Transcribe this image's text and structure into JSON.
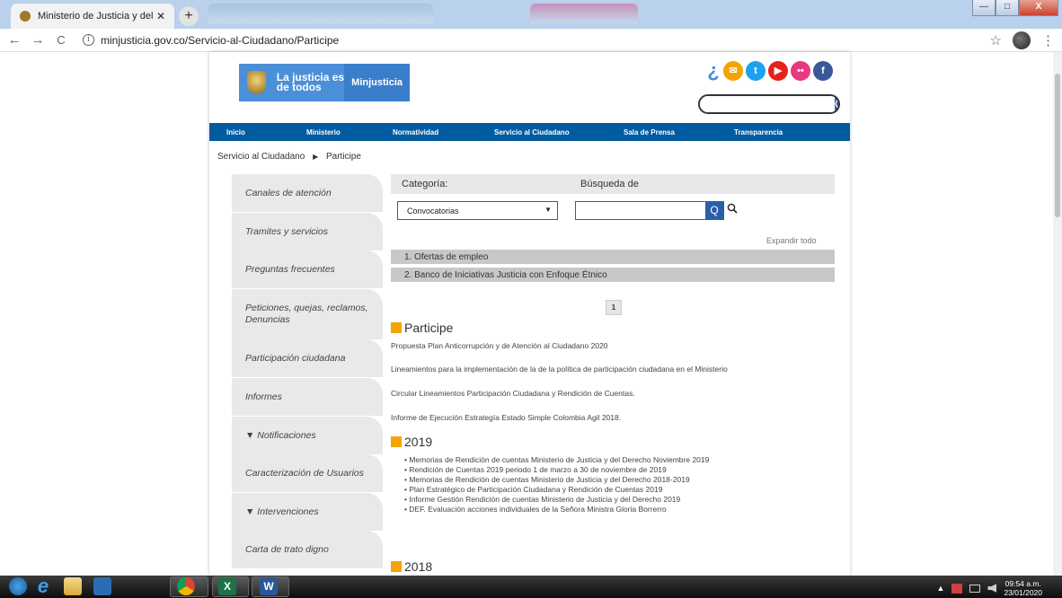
{
  "browser": {
    "tab_title": "Ministerio de Justicia y del Dere¢",
    "tab_close": "✕",
    "new_tab": "+",
    "url": "minjusticia.gov.co/Servicio-al-Ciudadano/Participe",
    "back": "←",
    "forward": "→",
    "reload": "C",
    "info": "i",
    "star": "☆",
    "menu": "⋮",
    "win_min": "—",
    "win_max": "□",
    "win_close": "X"
  },
  "header": {
    "slogan": "La justicia es de todos",
    "brand": "Minjusticia",
    "accessibility_glyph": "¿",
    "social_icons": [
      {
        "name": "chat",
        "glyph": "✉",
        "color": "#f5a300"
      },
      {
        "name": "twitter",
        "glyph": "t",
        "color": "#1da1f2"
      },
      {
        "name": "youtube",
        "glyph": "▶",
        "color": "#e62117"
      },
      {
        "name": "flickr",
        "glyph": "••",
        "color": "#e8387f"
      },
      {
        "name": "facebook",
        "glyph": "f",
        "color": "#3b5998"
      }
    ],
    "search_glyph": "Q"
  },
  "nav": {
    "items": [
      "Inicio",
      "Ministerio",
      "Normatividad",
      "Servicio al Ciudadano",
      "Sala de Prensa",
      "Transparencia"
    ]
  },
  "breadcrumb": {
    "parent": "Servicio al Ciudadano",
    "arrow": "▶",
    "current": "Participe"
  },
  "sidebar": {
    "items": [
      "Canales de atención",
      "Tramites y servicios",
      "Preguntas frecuentes",
      "Peticiones, quejas, reclamos, Denuncias",
      "Participación ciudadana",
      "Informes",
      "▼ Notificaciones",
      "Caracterización de Usuarios",
      "▼ Intervenciones",
      "Carta de trato digno"
    ]
  },
  "filter": {
    "category_label": "Categoría:",
    "search_label": "Búsqueda de",
    "category_value": "Convocatorias",
    "caret": "▼",
    "search_glyph": "Q",
    "expand_all": "Expandir todo"
  },
  "accordion": [
    "1. Ofertas de empleo",
    "2. Banco de Iniciativas Justicia con Enfoque Étnico"
  ],
  "pager": {
    "current": "1"
  },
  "participe": {
    "title": "Participe",
    "items": [
      "Propuesta Plan Anticorrupción y de Atención al Ciudadano 2020",
      "Lineamientos para la implementación de la de la política de participación ciudadana en el Ministerio",
      "Circular Lineamientos Participación Ciudadana y Rendición de Cuentas.",
      "Informe de Ejecución Estrategía Estado Simple Colombia Agil 2018."
    ]
  },
  "year2019": {
    "title": "2019",
    "items": [
      "• Memorias de Rendición de cuentas Ministerio de Justicia y del Derecho Noviembre 2019",
      "• Rendición de Cuentas 2019 periodo 1 de marzo a 30 de noviembre de 2019",
      "• Memorias de Rendición de cuentas Ministerio de Justicia y del Derecho 2018-2019",
      "• Plan Estratégico de Participación Ciudadana y Rendición de Cuentas 2019",
      "• Informe Gestión Rendición de cuentas Ministerio de Justicia y del Derecho 2019",
      "• DEF. Evaluación acciones individuales de la Señora Ministra Gloria Borrerro"
    ]
  },
  "year2018": {
    "title": "2018"
  },
  "taskbar": {
    "time": "09:54 a.m.",
    "date": "23/01/2020",
    "tray_arrow": "▲",
    "excel": "X",
    "word": "W",
    "ie": "e"
  }
}
